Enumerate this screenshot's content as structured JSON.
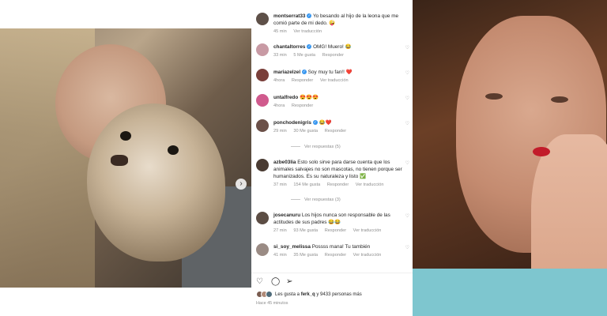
{
  "colors": {
    "accent": "#3897f0",
    "heart": "#e0245e",
    "muted": "#8e8e8e"
  },
  "carousel": {
    "next_icon": "chevron-right-icon",
    "next_glyph": "›"
  },
  "comments": [
    {
      "user": "montserrat33",
      "verified": true,
      "text": "Yo besando al hijo de la leona que me comió parte de mi dedo. 🤪",
      "meta": [
        "45 min",
        "Ver traducción"
      ],
      "avatar_color": "#5e5048"
    },
    {
      "user": "chantaltorres",
      "verified": true,
      "text": "OMG! Muero! 😂",
      "meta": [
        "33 min",
        "5 Me gusta",
        "Responder"
      ],
      "avatar_color": "#c89aa4"
    },
    {
      "user": "mariazelzel",
      "verified": true,
      "text": "Soy muy tu fan!! ❤️",
      "meta": [
        "4hora",
        "Responder",
        "Ver traducción"
      ],
      "avatar_color": "#7a3f3a"
    },
    {
      "user": "untalfredo",
      "verified": false,
      "text": "😍😍😍",
      "meta": [
        "4hora",
        "Responder"
      ],
      "avatar_color": "#d05a8d"
    },
    {
      "user": "ponchodenigris",
      "verified": true,
      "text": "😂❤️",
      "meta": [
        "29 min",
        "30 Me gusta",
        "Responder"
      ],
      "avatar_color": "#6b5048",
      "see_replies": "Ver respuestas (5)"
    },
    {
      "user": "azbe03lia",
      "verified": false,
      "text": "Esto solo sirve para darse cuenta que los animales salvajes no son mascotas, no tienen porque ser humanizados. Es su naturaleza y listo ✅",
      "meta": [
        "37 min",
        "154 Me gusta",
        "Responder",
        "Ver traducción"
      ],
      "avatar_color": "#4a3b32",
      "see_replies": "Ver respuestas (3)"
    },
    {
      "user": "josecanuru",
      "verified": false,
      "text": "Los hijos nunca son responsable de las actitudes de sus padres 😂😂",
      "meta": [
        "27 min",
        "93 Me gusta",
        "Responder",
        "Ver traducción"
      ],
      "avatar_color": "#5c4d44"
    },
    {
      "user": "si_soy_melissa",
      "verified": false,
      "text": "Possss mana! Tu también",
      "meta": [
        "41 min",
        "35 Me gusta",
        "Responder",
        "Ver traducción"
      ],
      "avatar_color": "#9a8b84"
    }
  ],
  "actions": {
    "like_icon": "heart-icon",
    "comment_icon": "comment-icon",
    "share_icon": "share-icon"
  },
  "likes": {
    "prefix": "Les gusta a ",
    "user": "ferk_q",
    "suffix": " y 9433 personas más",
    "avatar_colors": [
      "#7a5c50",
      "#b08a78",
      "#4f6b7a"
    ]
  },
  "posted": "Hace 45 minutos"
}
